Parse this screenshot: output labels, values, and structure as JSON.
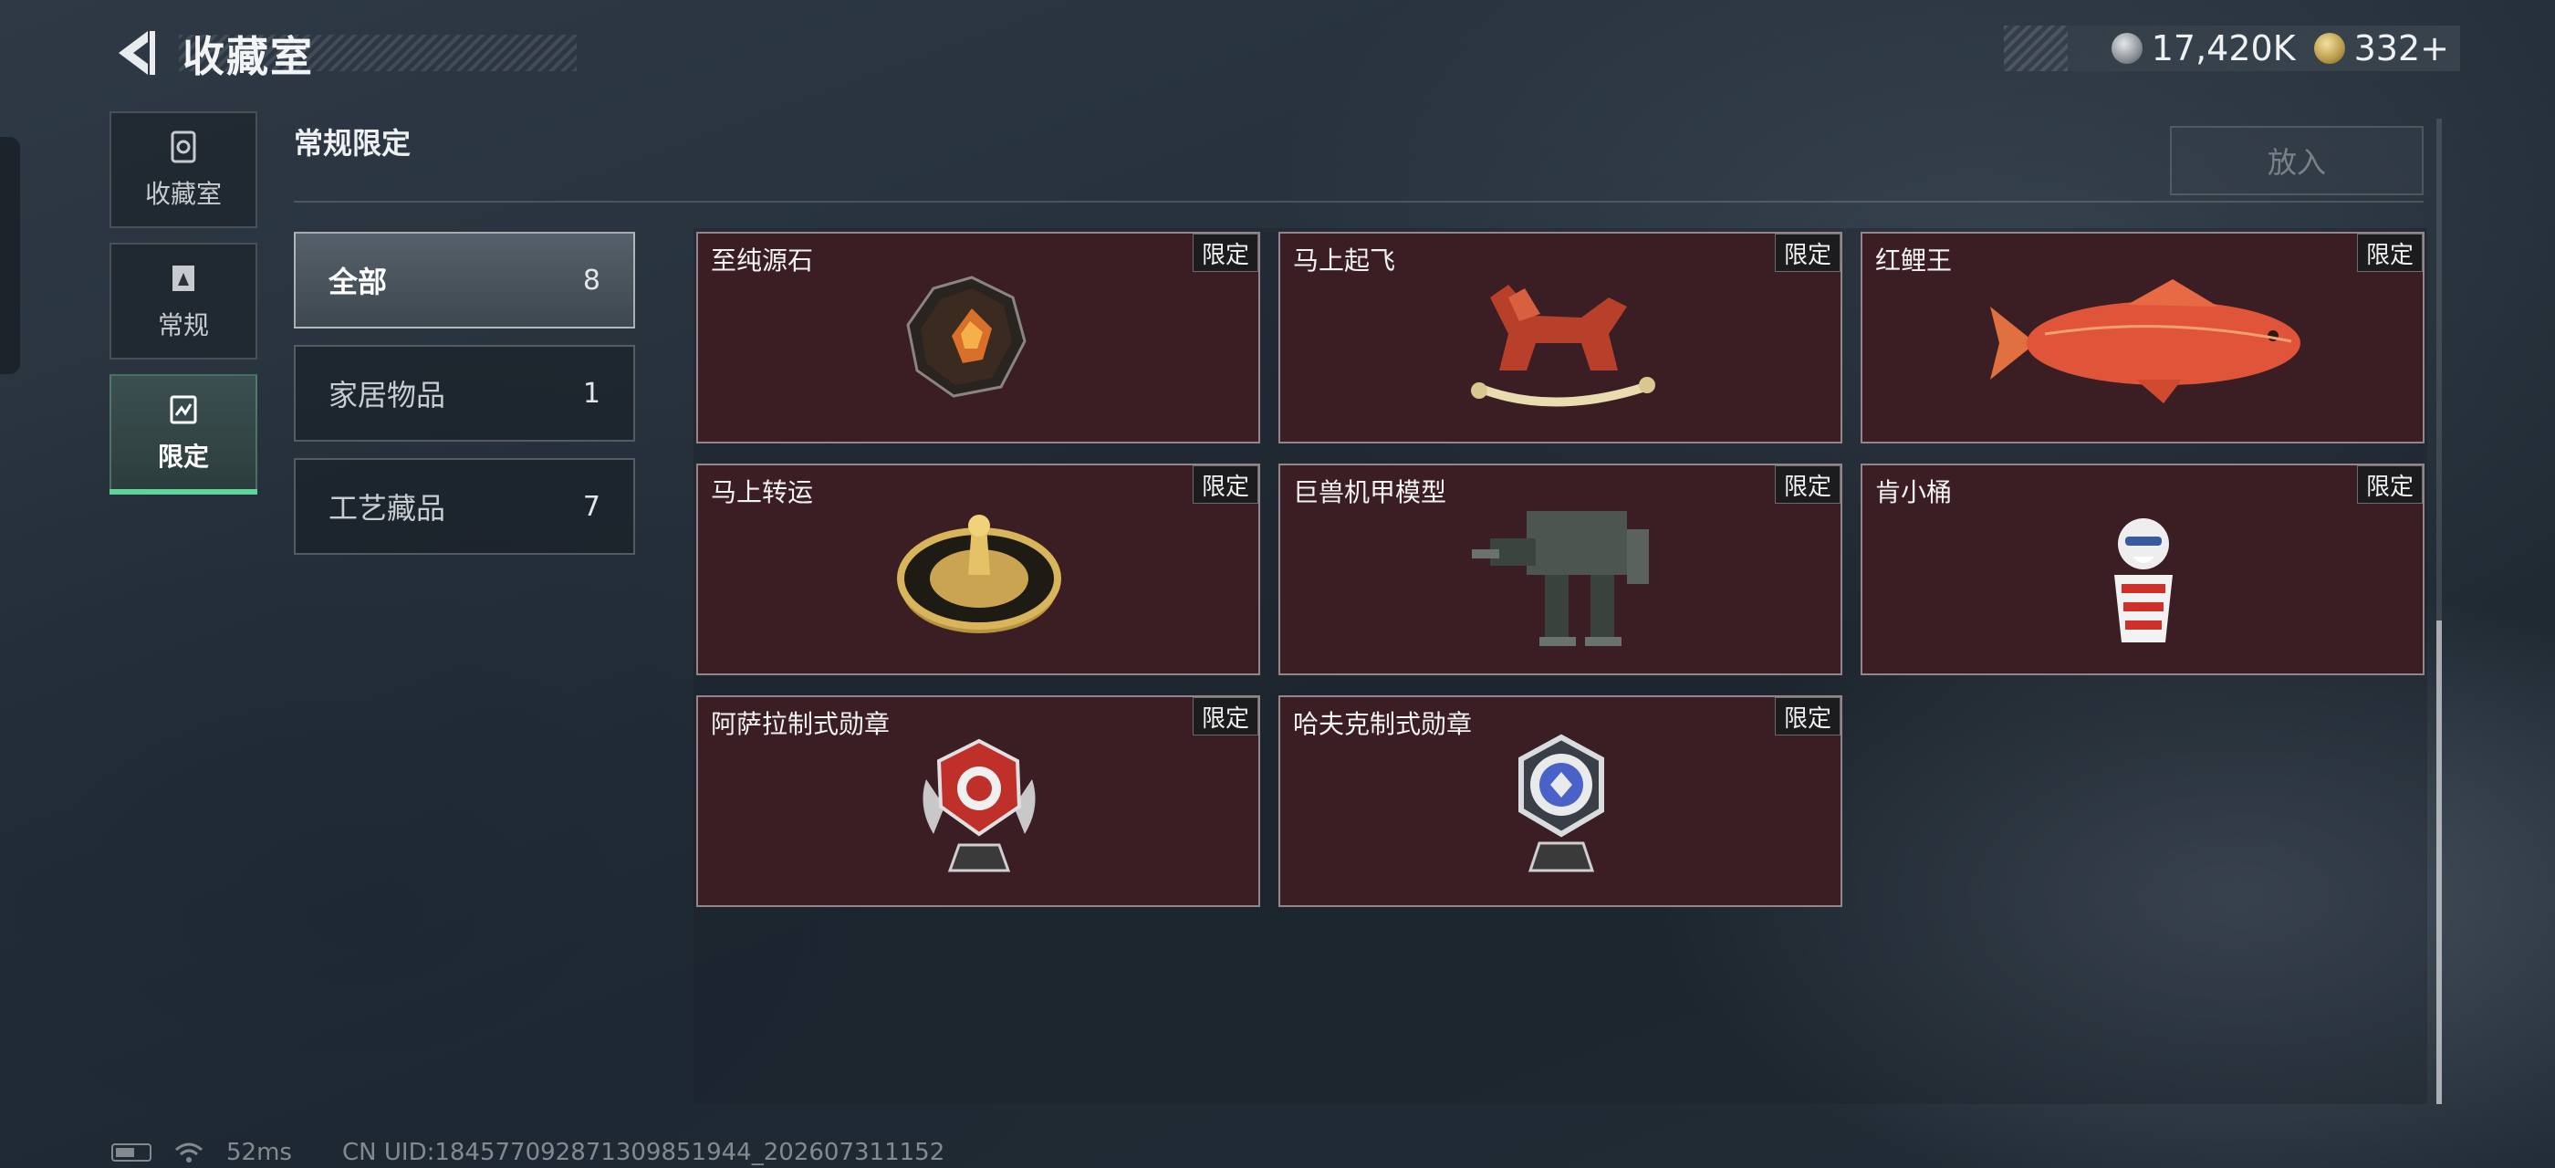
{
  "header": {
    "title": "收藏室",
    "currencies": [
      {
        "icon": "silver-coin-icon",
        "value": "17,420K"
      },
      {
        "icon": "gold-coin-icon",
        "value": "332+"
      }
    ]
  },
  "nav": [
    {
      "label": "收藏室",
      "icon": "collection-room-icon",
      "active": false
    },
    {
      "label": "常规",
      "icon": "regular-icon",
      "active": false
    },
    {
      "label": "限定",
      "icon": "limited-icon",
      "active": true
    }
  ],
  "section": {
    "title": "常规限定",
    "put_button": "放入"
  },
  "categories": [
    {
      "name": "全部",
      "count": "8",
      "active": true
    },
    {
      "name": "家居物品",
      "count": "1",
      "active": false
    },
    {
      "name": "工艺藏品",
      "count": "7",
      "active": false
    }
  ],
  "items": [
    {
      "name": "至纯源石",
      "badge": "限定",
      "icon": "dark-stone-icon"
    },
    {
      "name": "马上起飞",
      "badge": "限定",
      "icon": "horse-rocker-icon"
    },
    {
      "name": "红鲤王",
      "badge": "限定",
      "icon": "red-carp-icon"
    },
    {
      "name": "马上转运",
      "badge": "限定",
      "icon": "gold-wheel-icon"
    },
    {
      "name": "巨兽机甲模型",
      "badge": "限定",
      "icon": "mech-model-icon"
    },
    {
      "name": "肯小桶",
      "badge": "限定",
      "icon": "bucket-figure-icon"
    },
    {
      "name": "阿萨拉制式勋章",
      "badge": "限定",
      "icon": "red-medal-icon"
    },
    {
      "name": "哈夫克制式勋章",
      "badge": "限定",
      "icon": "blue-medal-icon"
    }
  ],
  "status": {
    "latency": "52ms",
    "uid": "CN UID:18457709287130985​1944_202607311152"
  },
  "colors": {
    "accent": "#5fd39b",
    "card_bg": "#3a1e24"
  }
}
